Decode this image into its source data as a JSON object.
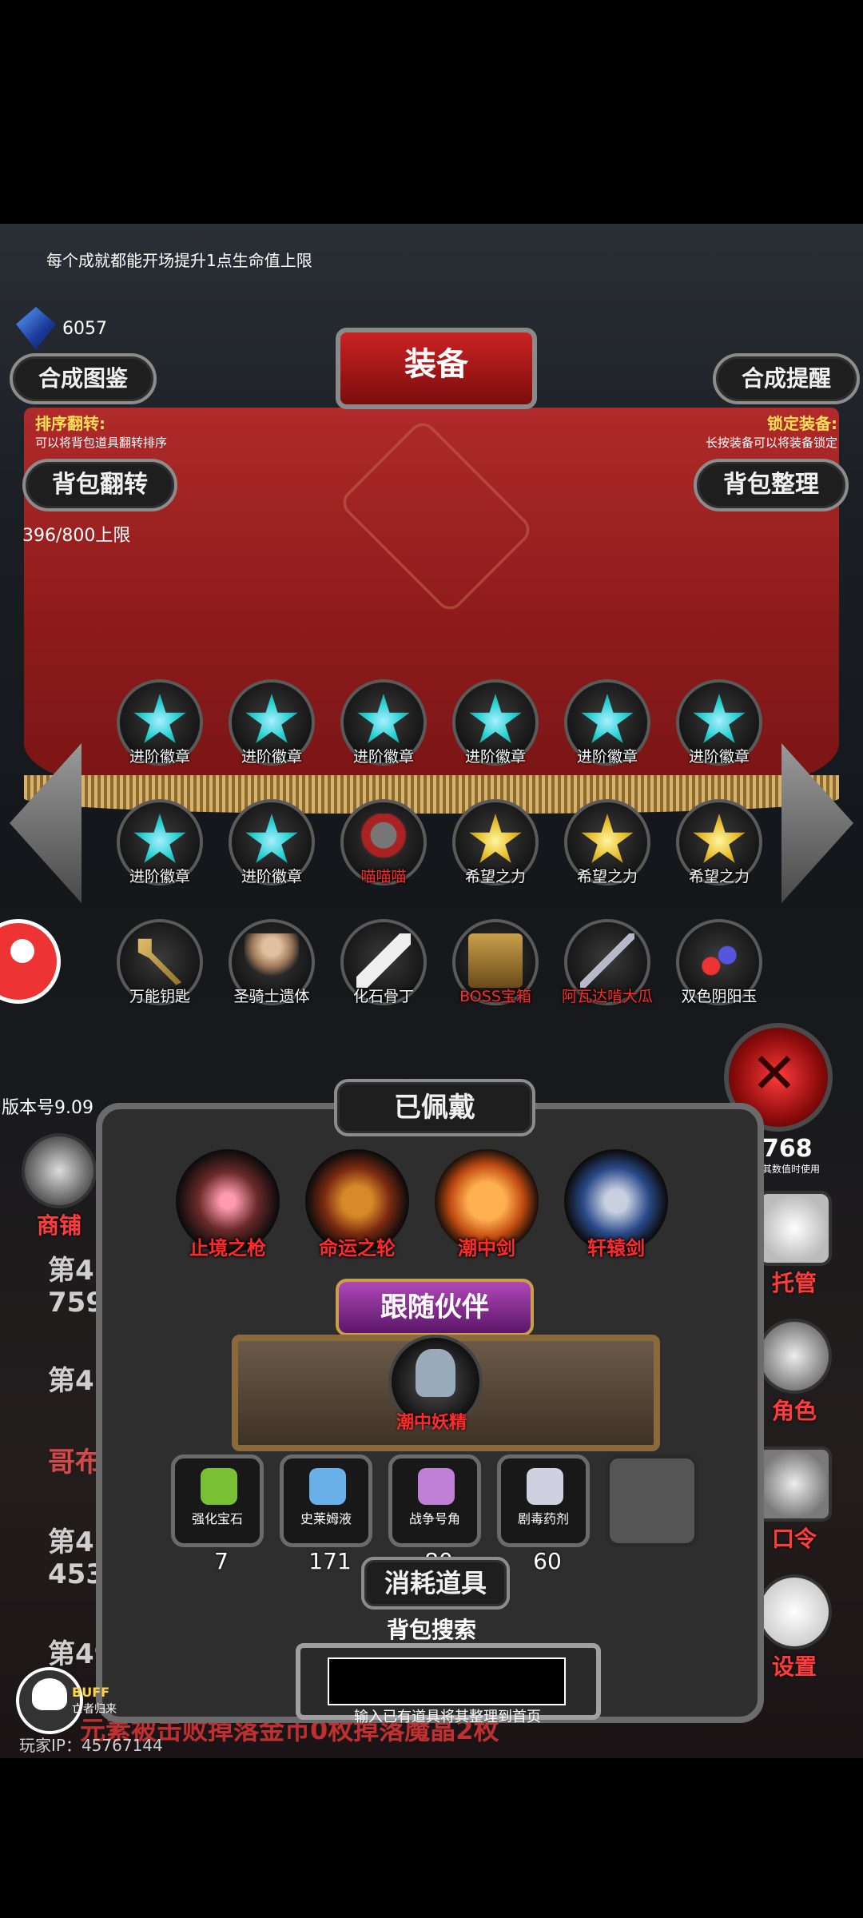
{
  "tip": "每个成就都能开场提升1点生命值上限",
  "gems": "6057",
  "title": "装备",
  "buttons": {
    "synth_atlas": "合成图鉴",
    "synth_remind": "合成提醒",
    "bag_flip": "背包翻转",
    "bag_sort": "背包整理"
  },
  "sort_flip": {
    "label": "排序翻转:",
    "desc": "可以将背包道具翻转排序"
  },
  "lock_equip": {
    "label": "锁定装备:",
    "desc": "长按装备可以将装备锁定"
  },
  "capacity": "396/800上限",
  "items": [
    {
      "label": "进阶徽章",
      "icon": "cyan-star-icon"
    },
    {
      "label": "进阶徽章",
      "icon": "cyan-star-icon"
    },
    {
      "label": "进阶徽章",
      "icon": "cyan-star-icon"
    },
    {
      "label": "进阶徽章",
      "icon": "cyan-star-icon"
    },
    {
      "label": "进阶徽章",
      "icon": "cyan-star-icon"
    },
    {
      "label": "进阶徽章",
      "icon": "cyan-star-icon"
    },
    {
      "label": "进阶徽章",
      "icon": "cyan-star-icon"
    },
    {
      "label": "进阶徽章",
      "icon": "cyan-star-icon"
    },
    {
      "label": "喵喵喵",
      "icon": "cat-warrior-icon",
      "red": true
    },
    {
      "label": "希望之力",
      "icon": "gold-star-icon"
    },
    {
      "label": "希望之力",
      "icon": "gold-star-icon"
    },
    {
      "label": "希望之力",
      "icon": "gold-star-icon"
    },
    {
      "label": "万能钥匙",
      "icon": "key-icon"
    },
    {
      "label": "圣骑士遗体",
      "icon": "corpse-icon"
    },
    {
      "label": "化石骨丁",
      "icon": "bone-icon"
    },
    {
      "label": "BOSS宝箱",
      "icon": "chest-icon",
      "red": true
    },
    {
      "label": "阿瓦达啃大瓜",
      "icon": "staff-icon",
      "red": true
    },
    {
      "label": "双色阴阳玉",
      "icon": "orbs-icon"
    }
  ],
  "version": "版本号9.09",
  "equipped_title": "已佩戴",
  "equipped": [
    "止境之枪",
    "命运之轮",
    "潮中剑",
    "轩辕剑"
  ],
  "companion_title": "跟随伙伴",
  "companion": "潮中妖精",
  "consumables": [
    {
      "name": "强化宝石",
      "qty": "7"
    },
    {
      "name": "史莱姆液",
      "qty": "171"
    },
    {
      "name": "战争号角",
      "qty": "80"
    },
    {
      "name": "剧毒药剂",
      "qty": "60"
    },
    {
      "name": "",
      "qty": ""
    }
  ],
  "consumables_title": "消耗道具",
  "search": {
    "title": "背包搜索",
    "hint": "输入已有道具将其整理到首页"
  },
  "side": {
    "shop": "商铺",
    "manage": "托管",
    "role": "角色",
    "code": "口令",
    "settings": "设置",
    "right_top_big": "768",
    "right_top_small": "其数值时使用"
  },
  "logs": {
    "l1": "第4",
    "l2": "759",
    "l3": "第4",
    "l4": "哥布",
    "l5": "第4",
    "l6": "453",
    "l7": "第49144回:发现游",
    "l8": "元素被击败掉落金币0枚掉落魔晶2枚"
  },
  "buff": {
    "label": "BUFF",
    "desc": "亡者归来"
  },
  "player_ip": "玩家IP：45767144"
}
